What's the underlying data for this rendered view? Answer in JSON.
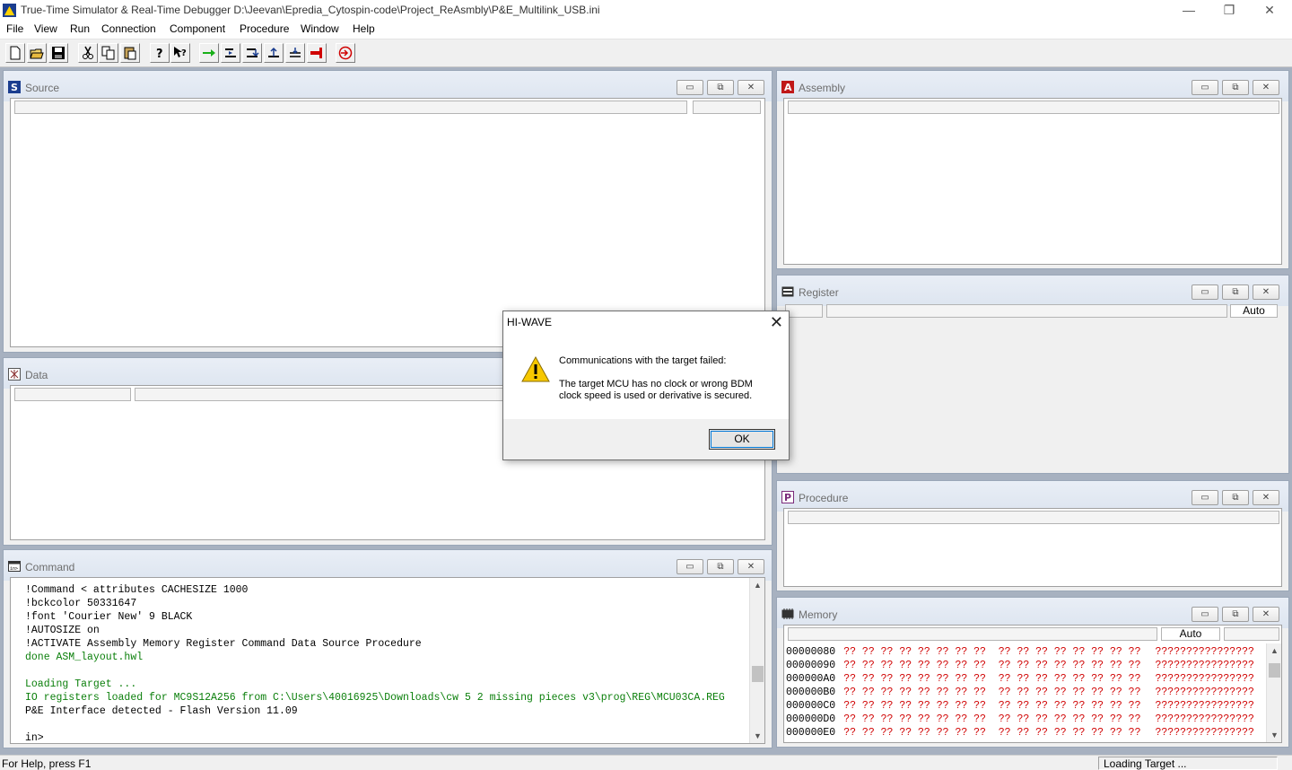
{
  "window": {
    "title": "True-Time Simulator & Real-Time Debugger  D:\\Jeevan\\Epredia_Cytospin-code\\Project_ReAsmbly\\P&E_Multilink_USB.ini",
    "minimize": "—",
    "restore": "❐",
    "close": "✕"
  },
  "menu": [
    "File",
    "View",
    "Run",
    "Connection",
    "Component",
    "Procedure",
    "Window",
    "Help"
  ],
  "toolbar": {
    "icons": [
      "new-file-icon",
      "open-folder-icon",
      "save-icon",
      "cut-icon",
      "copy-icon",
      "paste-icon",
      "help-icon",
      "context-help-icon",
      "start-continue-icon",
      "single-step-icon",
      "step-over-icon",
      "step-out-icon",
      "assembly-step-icon",
      "halt-icon",
      "reset-target-icon"
    ]
  },
  "child_buttons": {
    "minimize": "▭",
    "maximize": "⧉",
    "close": "✕"
  },
  "source": {
    "title": "Source"
  },
  "data": {
    "title": "Data"
  },
  "assembly": {
    "title": "Assembly"
  },
  "register": {
    "title": "Register",
    "mode": "Auto"
  },
  "procedure": {
    "title": "Procedure"
  },
  "memory": {
    "title": "Memory",
    "mode": "Auto",
    "rows": [
      {
        "addr": "00000080",
        "bytes": "?? ?? ?? ?? ?? ?? ?? ??  ?? ?? ?? ?? ?? ?? ?? ??",
        "ascii": "????????????????"
      },
      {
        "addr": "00000090",
        "bytes": "?? ?? ?? ?? ?? ?? ?? ??  ?? ?? ?? ?? ?? ?? ?? ??",
        "ascii": "????????????????"
      },
      {
        "addr": "000000A0",
        "bytes": "?? ?? ?? ?? ?? ?? ?? ??  ?? ?? ?? ?? ?? ?? ?? ??",
        "ascii": "????????????????"
      },
      {
        "addr": "000000B0",
        "bytes": "?? ?? ?? ?? ?? ?? ?? ??  ?? ?? ?? ?? ?? ?? ?? ??",
        "ascii": "????????????????"
      },
      {
        "addr": "000000C0",
        "bytes": "?? ?? ?? ?? ?? ?? ?? ??  ?? ?? ?? ?? ?? ?? ?? ??",
        "ascii": "????????????????"
      },
      {
        "addr": "000000D0",
        "bytes": "?? ?? ?? ?? ?? ?? ?? ??  ?? ?? ?? ?? ?? ?? ?? ??",
        "ascii": "????????????????"
      },
      {
        "addr": "000000E0",
        "bytes": "?? ?? ?? ?? ?? ?? ?? ??  ?? ?? ?? ?? ?? ?? ?? ??",
        "ascii": "????????????????"
      }
    ]
  },
  "command": {
    "title": "Command",
    "lines": [
      {
        "text": "!Command < attributes CACHESIZE 1000",
        "color": "black"
      },
      {
        "text": "!bckcolor 50331647",
        "color": "black"
      },
      {
        "text": "!font 'Courier New' 9 BLACK",
        "color": "black"
      },
      {
        "text": "!AUTOSIZE on",
        "color": "black"
      },
      {
        "text": "!ACTIVATE Assembly Memory Register Command Data Source Procedure",
        "color": "black"
      },
      {
        "text": "done ASM_layout.hwl",
        "color": "green"
      },
      {
        "text": "",
        "color": "black"
      },
      {
        "text": "Loading Target ...",
        "color": "green"
      },
      {
        "text": "IO registers loaded for MC9S12A256 from C:\\Users\\40016925\\Downloads\\cw 5 2 missing pieces v3\\prog\\REG\\MCU03CA.REG",
        "color": "green"
      },
      {
        "text": "P&E Interface detected - Flash Version 11.09",
        "color": "black"
      },
      {
        "text": "",
        "color": "black"
      },
      {
        "text": "in>",
        "color": "black"
      }
    ]
  },
  "dialog": {
    "title": "HI-WAVE",
    "close": "✕",
    "message1": "Communications with the target failed:",
    "message2": "The target MCU has no clock or wrong BDM clock speed is used or derivative is secured.",
    "ok": "OK"
  },
  "status": {
    "help": "For Help, press F1",
    "right": "Loading Target ..."
  }
}
